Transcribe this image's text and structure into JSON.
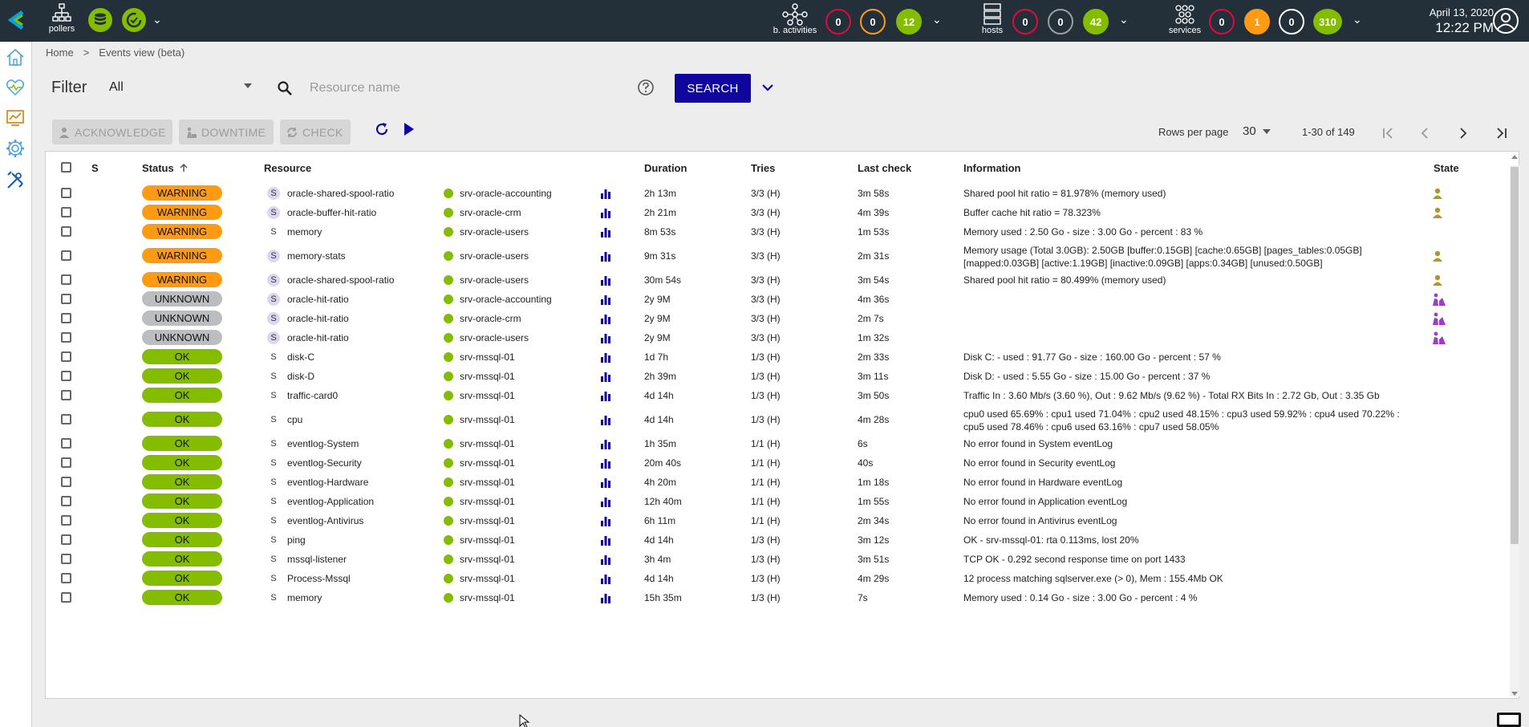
{
  "colors": {
    "topbar": "#232f39",
    "accent": "#10069f",
    "warning": "#ff9a13",
    "unknown": "#bcbdc0",
    "ok": "#84bd00",
    "critical": "#e00b3d"
  },
  "header": {
    "pollers_label": "pollers",
    "activities": {
      "label": "b. activities",
      "counts": [
        "0",
        "0",
        "12"
      ]
    },
    "hosts": {
      "label": "hosts",
      "counts": [
        "0",
        "0",
        "42"
      ]
    },
    "services": {
      "label": "services",
      "counts": [
        "0",
        "1",
        "0",
        "310"
      ]
    },
    "date": "April 13, 2020",
    "time": "12:22 PM"
  },
  "breadcrumb": {
    "home": "Home",
    "separator": ">",
    "current": "Events view (beta)"
  },
  "filter": {
    "label": "Filter",
    "selected": "All",
    "search_placeholder": "Resource name",
    "search_button": "SEARCH"
  },
  "actions": {
    "acknowledge": "ACKNOWLEDGE",
    "downtime": "DOWNTIME",
    "check": "CHECK"
  },
  "pagination": {
    "rows_per_page_label": "Rows per page",
    "rows_per_page": "30",
    "range": "1-30 of 149"
  },
  "table": {
    "columns": {
      "s": "S",
      "status": "Status",
      "resource": "Resource",
      "duration": "Duration",
      "tries": "Tries",
      "last_check": "Last check",
      "information": "Information",
      "state": "State"
    },
    "rows": [
      {
        "status": "WARNING",
        "type": "S",
        "resource": "oracle-shared-spool-ratio",
        "host": "srv-oracle-accounting",
        "duration": "2h 13m",
        "tries": "3/3 (H)",
        "last_check": "3m 58s",
        "information": "Shared pool hit ratio = 81.978% (memory used)",
        "info2": "",
        "state": "ack"
      },
      {
        "status": "WARNING",
        "type": "S",
        "resource": "oracle-buffer-hit-ratio",
        "host": "srv-oracle-crm",
        "duration": "2h 21m",
        "tries": "3/3 (H)",
        "last_check": "4m 39s",
        "information": "Buffer cache hit ratio = 78.323%",
        "info2": "",
        "state": "ack"
      },
      {
        "status": "WARNING",
        "type": "S",
        "resource": "memory",
        "host": "srv-oracle-users",
        "duration": "8m 53s",
        "tries": "3/3 (H)",
        "last_check": "1m 53s",
        "information": "Memory used : 2.50 Go - size : 3.00 Go - percent : 83 %",
        "info2": "",
        "state": ""
      },
      {
        "status": "WARNING",
        "type": "S",
        "resource": "memory-stats",
        "host": "srv-oracle-users",
        "duration": "9m 31s",
        "tries": "3/3 (H)",
        "last_check": "2m 31s",
        "information": "Memory usage (Total 3.0GB): 2.50GB [buffer:0.15GB] [cache:0.65GB] [pages_tables:0.05GB]",
        "info2": "[mapped:0.03GB] [active:1.19GB] [inactive:0.09GB] [apps:0.34GB] [unused:0.50GB]",
        "state": "ack"
      },
      {
        "status": "WARNING",
        "type": "S",
        "resource": "oracle-shared-spool-ratio",
        "host": "srv-oracle-users",
        "duration": "30m 54s",
        "tries": "3/3 (H)",
        "last_check": "3m 54s",
        "information": "Shared pool hit ratio = 80.499% (memory used)",
        "info2": "",
        "state": "ack"
      },
      {
        "status": "UNKNOWN",
        "type": "S",
        "resource": "oracle-hit-ratio",
        "host": "srv-oracle-accounting",
        "duration": "2y 9M",
        "tries": "3/3 (H)",
        "last_check": "4m 36s",
        "information": "",
        "info2": "",
        "state": "downtime"
      },
      {
        "status": "UNKNOWN",
        "type": "S",
        "resource": "oracle-hit-ratio",
        "host": "srv-oracle-crm",
        "duration": "2y 9M",
        "tries": "3/3 (H)",
        "last_check": "2m 7s",
        "information": "",
        "info2": "",
        "state": "downtime"
      },
      {
        "status": "UNKNOWN",
        "type": "S",
        "resource": "oracle-hit-ratio",
        "host": "srv-oracle-users",
        "duration": "2y 9M",
        "tries": "3/3 (H)",
        "last_check": "1m 32s",
        "information": "",
        "info2": "",
        "state": "downtime"
      },
      {
        "status": "OK",
        "type": "S",
        "resource": "disk-C",
        "host": "srv-mssql-01",
        "duration": "1d 7h",
        "tries": "1/3 (H)",
        "last_check": "2m 33s",
        "information": "Disk C: - used : 91.77 Go - size : 160.00 Go - percent : 57 %",
        "info2": "",
        "state": ""
      },
      {
        "status": "OK",
        "type": "S",
        "resource": "disk-D",
        "host": "srv-mssql-01",
        "duration": "2h 39m",
        "tries": "1/3 (H)",
        "last_check": "3m 11s",
        "information": "Disk D: - used : 5.55 Go - size : 15.00 Go - percent : 37 %",
        "info2": "",
        "state": ""
      },
      {
        "status": "OK",
        "type": "S",
        "resource": "traffic-card0",
        "host": "srv-mssql-01",
        "duration": "4d 14h",
        "tries": "1/3 (H)",
        "last_check": "3m 50s",
        "information": "Traffic In : 3.60 Mb/s (3.60 %), Out : 9.62 Mb/s (9.62 %) - Total RX Bits In : 2.72 Gb, Out : 3.35 Gb",
        "info2": "",
        "state": ""
      },
      {
        "status": "OK",
        "type": "S",
        "resource": "cpu",
        "host": "srv-mssql-01",
        "duration": "4d 14h",
        "tries": "1/3 (H)",
        "last_check": "4m 28s",
        "information": "cpu0 used 65.69% : cpu1 used 71.04% : cpu2 used 48.15% : cpu3 used 59.92% : cpu4 used 70.22% :",
        "info2": "cpu5 used 78.46% : cpu6 used 63.16% : cpu7 used 58.05%",
        "state": ""
      },
      {
        "status": "OK",
        "type": "S",
        "resource": "eventlog-System",
        "host": "srv-mssql-01",
        "duration": "1h 35m",
        "tries": "1/1 (H)",
        "last_check": "6s",
        "information": "No error found in System eventLog",
        "info2": "",
        "state": ""
      },
      {
        "status": "OK",
        "type": "S",
        "resource": "eventlog-Security",
        "host": "srv-mssql-01",
        "duration": "20m 40s",
        "tries": "1/1 (H)",
        "last_check": "40s",
        "information": "No error found in Security eventLog",
        "info2": "",
        "state": ""
      },
      {
        "status": "OK",
        "type": "S",
        "resource": "eventlog-Hardware",
        "host": "srv-mssql-01",
        "duration": "4h 20m",
        "tries": "1/1 (H)",
        "last_check": "1m 18s",
        "information": "No error found in Hardware eventLog",
        "info2": "",
        "state": ""
      },
      {
        "status": "OK",
        "type": "S",
        "resource": "eventlog-Application",
        "host": "srv-mssql-01",
        "duration": "12h 40m",
        "tries": "1/1 (H)",
        "last_check": "1m 55s",
        "information": "No error found in Application eventLog",
        "info2": "",
        "state": ""
      },
      {
        "status": "OK",
        "type": "S",
        "resource": "eventlog-Antivirus",
        "host": "srv-mssql-01",
        "duration": "6h 11m",
        "tries": "1/1 (H)",
        "last_check": "2m 34s",
        "information": "No error found in Antivirus eventLog",
        "info2": "",
        "state": ""
      },
      {
        "status": "OK",
        "type": "S",
        "resource": "ping",
        "host": "srv-mssql-01",
        "duration": "4d 14h",
        "tries": "1/3 (H)",
        "last_check": "3m 12s",
        "information": "OK - srv-mssql-01: rta 0.113ms, lost 20%",
        "info2": "",
        "state": ""
      },
      {
        "status": "OK",
        "type": "S",
        "resource": "mssql-listener",
        "host": "srv-mssql-01",
        "duration": "3h 4m",
        "tries": "1/3 (H)",
        "last_check": "3m 51s",
        "information": "TCP OK - 0.292 second response time on port 1433",
        "info2": "",
        "state": ""
      },
      {
        "status": "OK",
        "type": "S",
        "resource": "Process-Mssql",
        "host": "srv-mssql-01",
        "duration": "4d 14h",
        "tries": "1/3 (H)",
        "last_check": "4m 29s",
        "information": "12 process matching sqlserver.exe (> 0), Mem : 155.4Mb OK",
        "info2": "",
        "state": ""
      },
      {
        "status": "OK",
        "type": "S",
        "resource": "memory",
        "host": "srv-mssql-01",
        "duration": "15h 35m",
        "tries": "1/3 (H)",
        "last_check": "7s",
        "information": "Memory used : 0.14 Go - size : 3.00 Go - percent : 4 %",
        "info2": "",
        "state": ""
      }
    ]
  }
}
